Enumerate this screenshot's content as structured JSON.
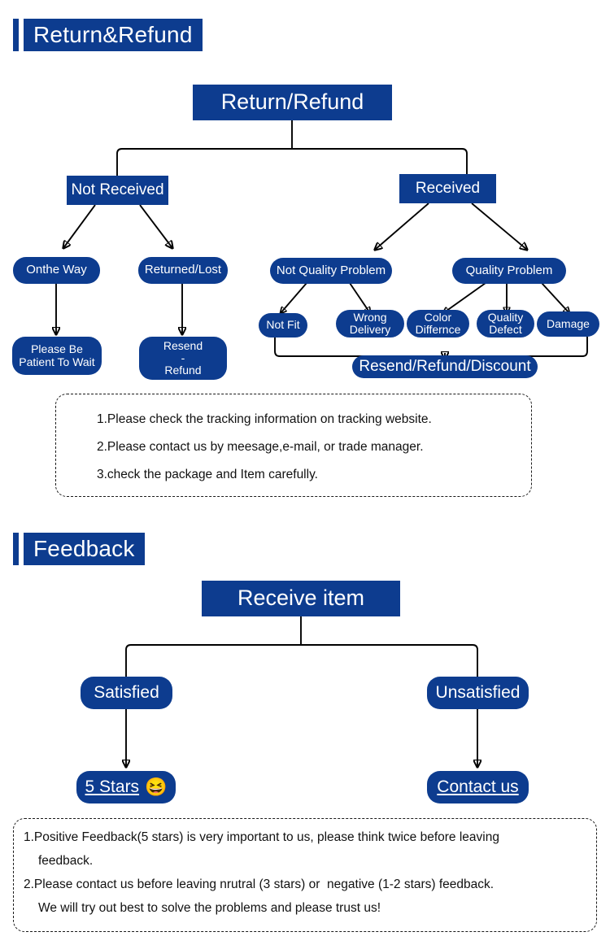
{
  "sections": [
    {
      "id": "return-refund",
      "title": "Return&Refund"
    },
    {
      "id": "feedback",
      "title": "Feedback"
    }
  ],
  "return_flow": {
    "root": "Return/Refund",
    "level1": [
      {
        "key": "not-received",
        "label": "Not Received"
      },
      {
        "key": "received",
        "label": "Received"
      }
    ],
    "level2": [
      {
        "key": "onthe-way",
        "label": "Onthe Way"
      },
      {
        "key": "returned-lost",
        "label": "Returned/Lost"
      },
      {
        "key": "not-quality-problem",
        "label": "Not Quality Problem"
      },
      {
        "key": "quality-problem",
        "label": "Quality Problem"
      }
    ],
    "level3": [
      {
        "key": "not-fit",
        "label": "Not Fit"
      },
      {
        "key": "wrong-delivery",
        "label": "Wrong\nDelivery"
      },
      {
        "key": "color-differnce",
        "label": "Color\nDiffernce"
      },
      {
        "key": "quality-defect",
        "label": "Quality\nDefect"
      },
      {
        "key": "damage",
        "label": "Damage"
      }
    ],
    "outcomes": [
      {
        "key": "please-be-patient",
        "label": "Please Be\nPatient To Wait"
      },
      {
        "key": "resend-refund",
        "label": "Resend\n-\nRefund"
      },
      {
        "key": "resend-refund-discount",
        "label": "Resend/Refund/Discount"
      }
    ]
  },
  "return_notes": [
    "1.Please check the tracking information on tracking website.",
    "2.Please contact us by meesage,e-mail, or trade manager.",
    "3.check the package and Item carefully."
  ],
  "feedback_flow": {
    "root": "Receive item",
    "level1": [
      {
        "key": "satisfied",
        "label": "Satisfied"
      },
      {
        "key": "unsatisfied",
        "label": "Unsatisfied"
      }
    ],
    "outcomes": [
      {
        "key": "five-stars",
        "label": "5 Stars",
        "emoji": "laughing-face-emoji",
        "glyph": "😆"
      },
      {
        "key": "contact-us",
        "label": "Contact us"
      }
    ]
  },
  "feedback_notes": [
    {
      "text": "1.Positive Feedback(5 stars) is very important to us, please think twice before leaving",
      "indented": false
    },
    {
      "text": "feedback.",
      "indented": true
    },
    {
      "text": "2.Please contact us before leaving nrutral (3 stars) or  negative (1-2 stars) feedback.",
      "indented": false
    },
    {
      "text": "We will try out best to solve the problems and please trust us!",
      "indented": true
    }
  ],
  "colors": {
    "brand_blue": "#0d3c8f",
    "text_on_blue": "#ffffff",
    "note_text": "#111111",
    "connector": "#000000",
    "background": "#ffffff"
  }
}
